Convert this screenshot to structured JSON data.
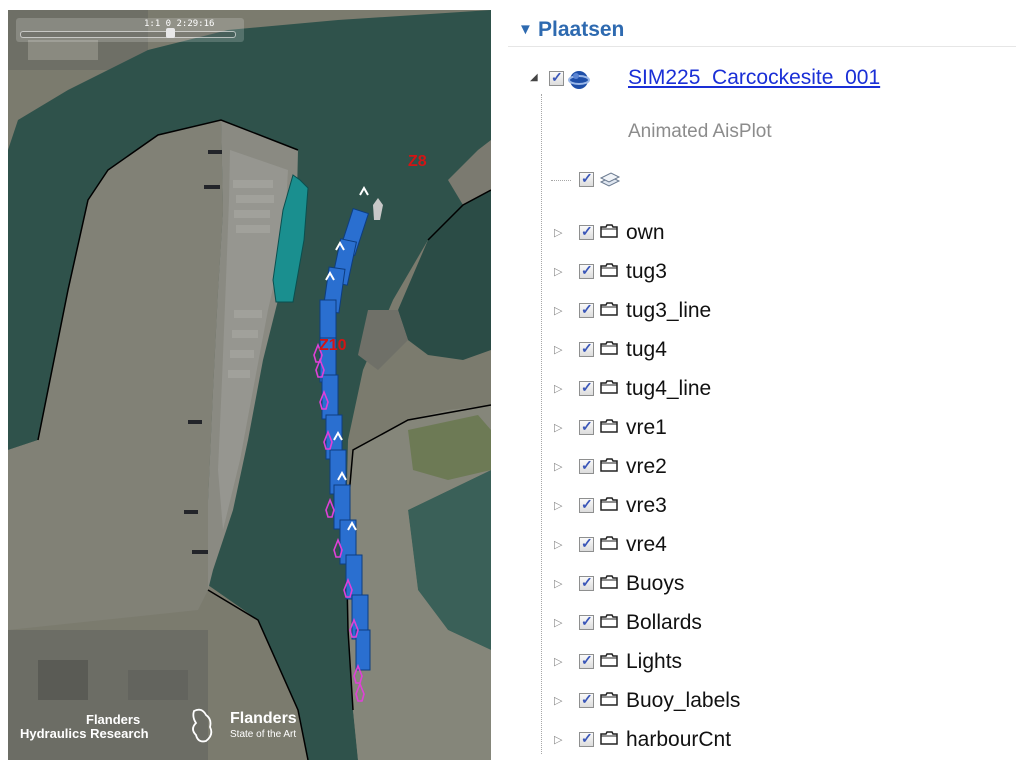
{
  "map": {
    "timeslider": {
      "text": "1:1   0   2:29:16"
    },
    "zone_labels": [
      {
        "id": "z8",
        "text": "Z8"
      },
      {
        "id": "z10",
        "text": "Z10"
      }
    ],
    "logos": {
      "fhr_line1": "Flanders",
      "fhr_line2": "Hydraulics Research",
      "flanders_main": "Flanders",
      "flanders_tagline": "State of the Art"
    },
    "colors": {
      "water": "#2f524b",
      "land": "#7d7d70",
      "vessel_blue": "#2a6fd0",
      "tug_magenta": "#e040d8",
      "moored_ship": "#1a8f8f",
      "zone_text": "#d41414"
    }
  },
  "places": {
    "title": "Plaatsen",
    "document": {
      "name": "SIM225_Carcockesite_001",
      "description": "Animated AisPlot",
      "checked": true
    },
    "folders": [
      {
        "label": "own",
        "checked": true
      },
      {
        "label": "tug3",
        "checked": true
      },
      {
        "label": "tug3_line",
        "checked": true
      },
      {
        "label": "tug4",
        "checked": true
      },
      {
        "label": "tug4_line",
        "checked": true
      },
      {
        "label": "vre1",
        "checked": true
      },
      {
        "label": "vre2",
        "checked": true
      },
      {
        "label": "vre3",
        "checked": true
      },
      {
        "label": "vre4",
        "checked": true
      },
      {
        "label": "Buoys",
        "checked": true
      },
      {
        "label": "Bollards",
        "checked": true
      },
      {
        "label": "Lights",
        "checked": true
      },
      {
        "label": "Buoy_labels",
        "checked": true
      },
      {
        "label": "harbourCnt",
        "checked": true
      }
    ],
    "colors": {
      "title": "#2e6ab0",
      "link": "#1a2fd6",
      "description": "#8c8c8c",
      "checkmark": "#3a56b8"
    }
  }
}
